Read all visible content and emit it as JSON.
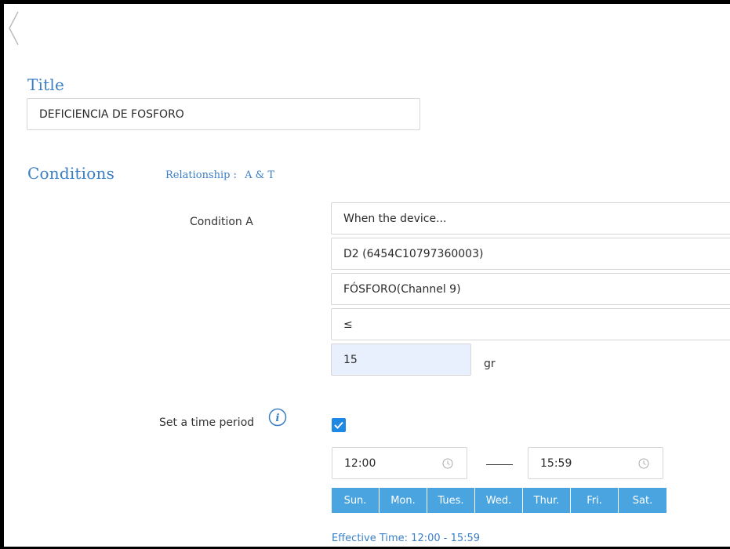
{
  "title_section": {
    "heading": "Title",
    "value": "DEFICIENCIA DE FOSFORO"
  },
  "conditions": {
    "heading": "Conditions",
    "relationship_label": "Relationship :",
    "relationship_value": "A & T",
    "condition_a": {
      "label": "Condition A",
      "trigger": "When the device...",
      "device": "D2 (6454C10797360003)",
      "channel": "FÓSFORO(Channel 9)",
      "operator": "≤",
      "threshold": "15",
      "unit": "gr"
    }
  },
  "time_period": {
    "label": "Set a time period",
    "enabled": true,
    "start": "12:00",
    "end": "15:59",
    "days": [
      "Sun.",
      "Mon.",
      "Tues.",
      "Wed.",
      "Thur.",
      "Fri.",
      "Sat."
    ],
    "effective": "Effective Time: 12:00 - 15:59"
  },
  "colors": {
    "accent": "#3a7fc6",
    "day_button": "#4aa4e0",
    "checkbox": "#1e88e5",
    "threshold_bg": "#e8f0fe"
  },
  "icons": [
    "chevron-left-icon",
    "info-icon",
    "check-icon",
    "clock-icon"
  ]
}
